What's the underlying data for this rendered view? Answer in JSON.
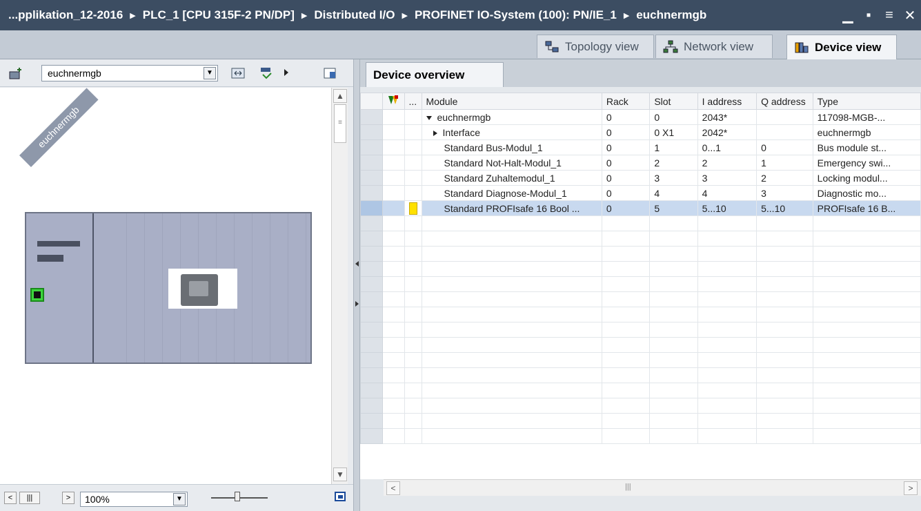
{
  "titlebar": {
    "crumbs": [
      "...pplikation_12-2016",
      "PLC_1 [CPU 315F-2 PN/DP]",
      "Distributed I/O",
      "PROFINET IO-System (100): PN/IE_1",
      "euchnermgb"
    ],
    "separator": "▶",
    "window_buttons": {
      "minimize": "▁",
      "restore": "▪",
      "menu": "≡",
      "close": "✕"
    }
  },
  "view_tabs": [
    {
      "label": "Topology view",
      "icon": "topology-icon"
    },
    {
      "label": "Network view",
      "icon": "network-icon"
    },
    {
      "label": "Device view",
      "icon": "device-icon"
    }
  ],
  "left_panel": {
    "device_combo": "euchnermgb",
    "combo_arrow": "▼",
    "device_name_label": "euchnermgb",
    "scroll_up": "▲",
    "scroll_down": "▼",
    "scroll_grip": "≡",
    "zoom": "100%",
    "scroll_left": "<",
    "scroll_right": ">",
    "scroll_hgrip": "|||"
  },
  "right_panel": {
    "tab": "Device overview",
    "columns": [
      "",
      "",
      "...",
      "Module",
      "Rack",
      "Slot",
      "I address",
      "Q address",
      "Type"
    ],
    "rows": [
      {
        "module": "euchnermgb",
        "expander": "down",
        "rack": "0",
        "slot": "0",
        "iaddr": "2043*",
        "qaddr": "",
        "type": "117098-MGB-..."
      },
      {
        "module": "Interface",
        "expander": "right",
        "rack": "0",
        "slot": "0 X1",
        "iaddr": "2042*",
        "qaddr": "",
        "type": "euchnermgb"
      },
      {
        "module": "Standard Bus-Modul_1",
        "expander": "",
        "rack": "0",
        "slot": "1",
        "iaddr": "0...1",
        "qaddr": "0",
        "type": "Bus module st..."
      },
      {
        "module": "Standard Not-Halt-Modul_1",
        "expander": "",
        "rack": "0",
        "slot": "2",
        "iaddr": "2",
        "qaddr": "1",
        "type": "Emergency swi..."
      },
      {
        "module": "Standard Zuhaltemodul_1",
        "expander": "",
        "rack": "0",
        "slot": "3",
        "iaddr": "3",
        "qaddr": "2",
        "type": "Locking modul..."
      },
      {
        "module": "Standard Diagnose-Modul_1",
        "expander": "",
        "rack": "0",
        "slot": "4",
        "iaddr": "4",
        "qaddr": "3",
        "type": "Diagnostic mo..."
      },
      {
        "module": "Standard PROFIsafe 16 Bool ...",
        "expander": "",
        "rack": "0",
        "slot": "5",
        "iaddr": "5...10",
        "qaddr": "5...10",
        "type": "PROFIsafe 16 B...",
        "selected": true,
        "marker": "yellow"
      }
    ],
    "empty_rows": 15,
    "hscroll_left": "<",
    "hscroll_right": ">",
    "hscroll_grip": "|||"
  }
}
